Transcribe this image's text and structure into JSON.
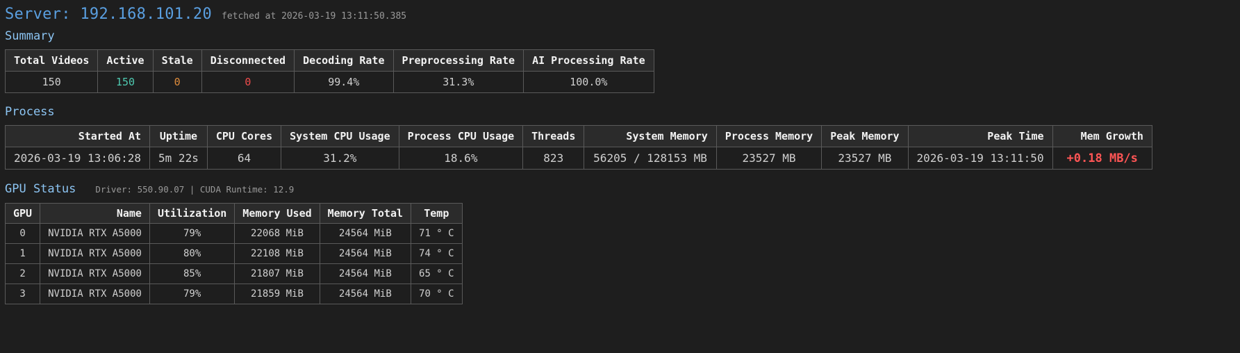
{
  "header": {
    "server_title": "Server: 192.168.101.20",
    "fetched_text": "fetched at 2026-03-19 13:11:50.385"
  },
  "summary": {
    "title": "Summary",
    "headers": [
      "Total Videos",
      "Active",
      "Stale",
      "Disconnected",
      "Decoding Rate",
      "Preprocessing Rate",
      "AI Processing Rate"
    ],
    "values": [
      "150",
      "150",
      "0",
      "0",
      "99.4%",
      "31.3%",
      "100.0%"
    ]
  },
  "process": {
    "title": "Process",
    "headers": [
      "Started At",
      "Uptime",
      "CPU Cores",
      "System CPU Usage",
      "Process CPU Usage",
      "Threads",
      "System Memory",
      "Process Memory",
      "Peak Memory",
      "Peak Time",
      "Mem Growth"
    ],
    "values": [
      "2026-03-19 13:06:28",
      "5m 22s",
      "64",
      "31.2%",
      "18.6%",
      "823",
      "56205 / 128153 MB",
      "23527 MB",
      "23527 MB",
      "2026-03-19 13:11:50",
      "+0.18 MB/s"
    ]
  },
  "gpu": {
    "title": "GPU Status",
    "driver_info": "Driver: 550.90.07 | CUDA Runtime: 12.9",
    "headers": [
      "GPU",
      "Name",
      "Utilization",
      "Memory Used",
      "Memory Total",
      "Temp"
    ],
    "rows": [
      [
        "0",
        "NVIDIA RTX A5000",
        "79%",
        "22068 MiB",
        "24564 MiB",
        "71 ° C"
      ],
      [
        "1",
        "NVIDIA RTX A5000",
        "80%",
        "22108 MiB",
        "24564 MiB",
        "74 ° C"
      ],
      [
        "2",
        "NVIDIA RTX A5000",
        "85%",
        "21807 MiB",
        "24564 MiB",
        "65 ° C"
      ],
      [
        "3",
        "NVIDIA RTX A5000",
        "79%",
        "21859 MiB",
        "24564 MiB",
        "70 ° C"
      ]
    ]
  },
  "colors": {
    "background": "#1e1e1e",
    "title_blue": "#5a9fe0",
    "section_blue": "#8cc4f2",
    "active_green": "#4ec9b0",
    "stale_orange": "#e08d3c",
    "disconnected_red": "#f14c4c",
    "growth_red": "#ff5555"
  }
}
